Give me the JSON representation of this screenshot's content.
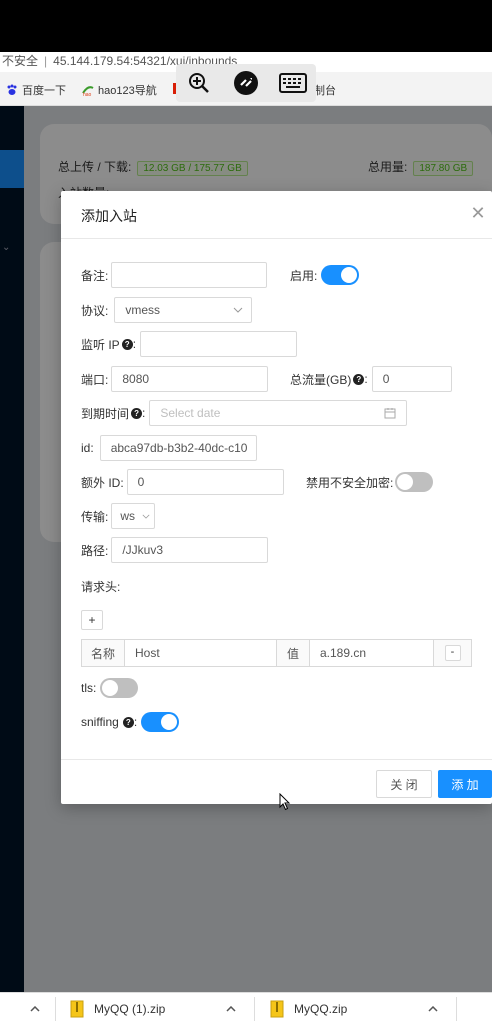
{
  "browser": {
    "url_prefix": "不安全",
    "url": "45.144.179.54:54321/xui/inbounds",
    "bookmarks": [
      "百度一下",
      "hao123导航",
      "制台"
    ]
  },
  "remote_toolbar": {
    "icons": [
      "zoom-in-icon",
      "remote-connection-icon",
      "keyboard-icon"
    ]
  },
  "background": {
    "upload_download_label": "总上传 / 下载:",
    "upload_download_value": "12.03 GB / 175.77 GB",
    "total_usage_label": "总用量:",
    "total_usage_value": "187.80 GB",
    "inbound_count_label": "入站数量:"
  },
  "modal": {
    "title": "添加入站",
    "remark_label": "备注:",
    "remark_value": "",
    "enable_label": "启用:",
    "enable_on": true,
    "protocol_label": "协议:",
    "protocol_value": "vmess",
    "listen_ip_label": "监听 IP",
    "listen_ip_value": "",
    "port_label": "端口:",
    "port_value": "8080",
    "total_traffic_label": "总流量(GB)",
    "total_traffic_value": "0",
    "expiry_label": "到期时间",
    "expiry_placeholder": "Select date",
    "id_label": "id:",
    "id_value": "abca97db-b3b2-40dc-c10",
    "alter_id_label": "额外 ID:",
    "alter_id_value": "0",
    "disable_insecure_label": "禁用不安全加密:",
    "disable_insecure_on": false,
    "transport_label": "传输:",
    "transport_value": "ws",
    "path_label": "路径:",
    "path_value": "/JJkuv3",
    "request_header_label": "请求头:",
    "add_header_symbol": "+",
    "header_name_label": "名称",
    "header_name_value": "Host",
    "header_value_label": "值",
    "header_value_value": "a.189.cn",
    "remove_header_symbol": "-",
    "tls_label": "tls:",
    "tls_on": false,
    "sniffing_label": "sniffing",
    "sniffing_on": true,
    "cancel_button": "关 闭",
    "add_button": "添 加"
  },
  "downloads": [
    {
      "name": "MyQQ (1).zip"
    },
    {
      "name": "MyQQ.zip"
    }
  ],
  "colors": {
    "primary": "#1890ff",
    "sidebar": "#001529",
    "tag_green": "#52c41a"
  }
}
